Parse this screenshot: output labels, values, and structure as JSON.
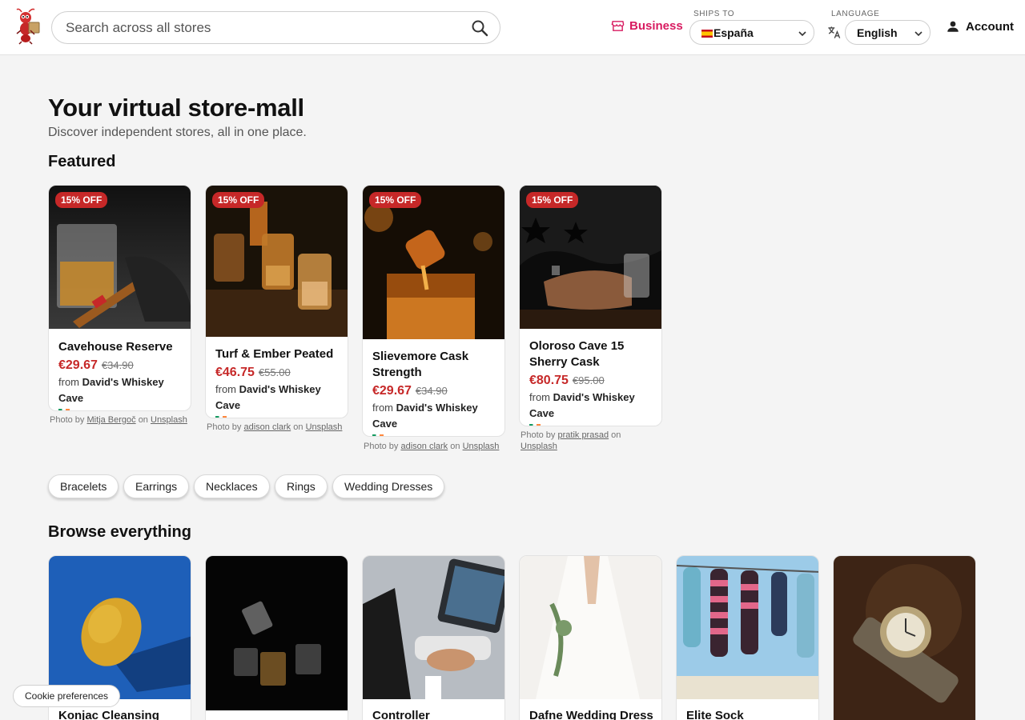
{
  "header": {
    "search_placeholder": "Search across all stores",
    "business_label": "Business",
    "ships_to_label": "SHIPS TO",
    "ships_to_value": "España",
    "language_label": "LANGUAGE",
    "language_value": "English",
    "account_label": "Account",
    "brand_color": "#d81b60"
  },
  "hero": {
    "title": "Your virtual store-mall",
    "subtitle": "Discover independent stores, all in one place."
  },
  "featured": {
    "title": "Featured",
    "items": [
      {
        "badge": "15% OFF",
        "name": "Cavehouse Reserve",
        "price": "€29.67",
        "old_price": "€34.90",
        "from": "from",
        "store": "David's Whiskey Cave",
        "credit_prefix": "Photo by",
        "photographer": "Mitja Bergoč",
        "credit_on": "on",
        "site": "Unsplash"
      },
      {
        "badge": "15% OFF",
        "name": "Turf & Ember Peated",
        "price": "€46.75",
        "old_price": "€55.00",
        "from": "from",
        "store": "David's Whiskey Cave",
        "credit_prefix": "Photo by",
        "photographer": "adison clark",
        "credit_on": "on",
        "site": "Unsplash"
      },
      {
        "badge": "15% OFF",
        "name": "Slievemore Cask Strength",
        "price": "€29.67",
        "old_price": "€34.90",
        "from": "from",
        "store": "David's Whiskey Cave",
        "credit_prefix": "Photo by",
        "photographer": "adison clark",
        "credit_on": "on",
        "site": "Unsplash"
      },
      {
        "badge": "15% OFF",
        "name": "Oloroso Cave 15 Sherry Cask",
        "price": "€80.75",
        "old_price": "€95.00",
        "from": "from",
        "store": "David's Whiskey Cave",
        "credit_prefix": "Photo by",
        "photographer": "pratik prasad",
        "credit_on": "on",
        "site": "Unsplash"
      }
    ]
  },
  "categories": [
    "Bracelets",
    "Earrings",
    "Necklaces",
    "Rings",
    "Wedding Dresses"
  ],
  "browse": {
    "title": "Browse everything",
    "items": [
      {
        "name": "Konjac Cleansing"
      },
      {
        "name": ""
      },
      {
        "name": "Controller"
      },
      {
        "name": "Dafne Wedding Dress"
      },
      {
        "name": "Elite Sock"
      },
      {
        "name": ""
      }
    ]
  },
  "cookie_label": "Cookie preferences",
  "colors": {
    "sale_red": "#c62828",
    "badge_red": "#c62828"
  }
}
